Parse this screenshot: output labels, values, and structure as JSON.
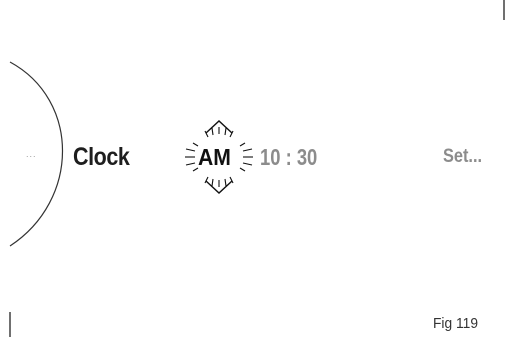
{
  "menu": {
    "previous_indicator": "...",
    "item_label": "Clock",
    "selected_value": "AM",
    "time_value": "10 : 30",
    "next_item_label": "Set..."
  },
  "figure_caption": "Fig 119",
  "icons": {
    "selector_dial": "arc-dial-icon",
    "adjust_up": "chevron-up-icon",
    "adjust_down": "chevron-down-icon",
    "blink_indicator": "blink-rays-icon"
  }
}
